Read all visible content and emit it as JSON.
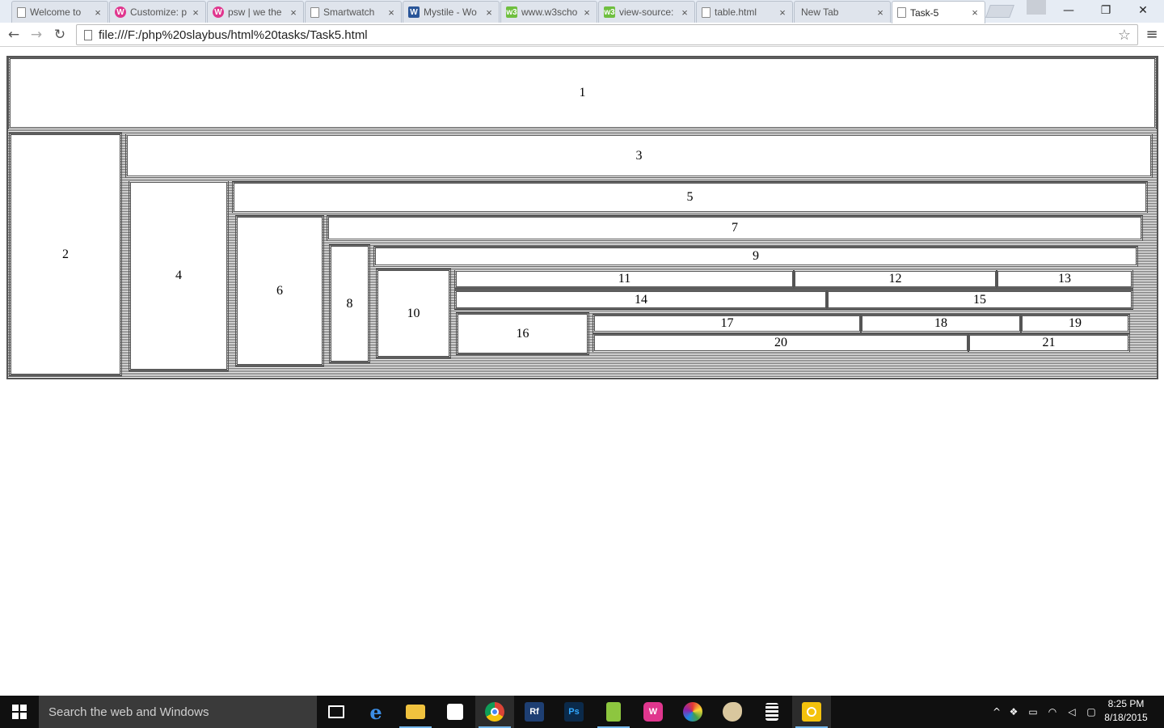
{
  "browser": {
    "tabs": [
      {
        "title": "Welcome to",
        "favicon": "doc-icon",
        "active": false
      },
      {
        "title": "Customize: p",
        "favicon": "wp-icon",
        "active": false
      },
      {
        "title": "psw | we the",
        "favicon": "wp-icon",
        "active": false
      },
      {
        "title": "Smartwatch",
        "favicon": "doc-icon",
        "active": false
      },
      {
        "title": "Mystile - Wo",
        "favicon": "w-icon",
        "active": false
      },
      {
        "title": "www.w3scho",
        "favicon": "w3-icon",
        "active": false
      },
      {
        "title": "view-source:",
        "favicon": "w3-icon",
        "active": false
      },
      {
        "title": "table.html",
        "favicon": "doc-icon",
        "active": false
      },
      {
        "title": "New Tab",
        "favicon": "none",
        "active": false
      },
      {
        "title": "Task-5",
        "favicon": "doc-icon",
        "active": true
      }
    ],
    "tab_close_glyph": "×",
    "url": "file:///F:/php%20slaybus/html%20tasks/Task5.html",
    "nav": {
      "back": "←",
      "forward": "→",
      "reload": "↻",
      "star": "☆",
      "menu": "≡"
    },
    "window_controls": {
      "minimize": "—",
      "restore": "❐",
      "close": "✕"
    }
  },
  "page": {
    "cells": {
      "c1": "1",
      "c2": "2",
      "c3": "3",
      "c4": "4",
      "c5": "5",
      "c6": "6",
      "c7": "7",
      "c8": "8",
      "c9": "9",
      "c10": "10",
      "c11": "11",
      "c12": "12",
      "c13": "13",
      "c14": "14",
      "c15": "15",
      "c16": "16",
      "c17": "17",
      "c18": "18",
      "c19": "19",
      "c20": "20",
      "c21": "21"
    }
  },
  "taskbar": {
    "search_placeholder": "Search the web and Windows",
    "apps": [
      {
        "name": "task-view-icon"
      },
      {
        "name": "edge-icon"
      },
      {
        "name": "file-explorer-icon"
      },
      {
        "name": "store-icon"
      },
      {
        "name": "chrome-icon"
      },
      {
        "name": "reflector-icon",
        "label": "Rf"
      },
      {
        "name": "photoshop-icon",
        "label": "Ps"
      },
      {
        "name": "notepad-plus-icon"
      },
      {
        "name": "wordpress-icon"
      },
      {
        "name": "paint-icon"
      },
      {
        "name": "paint-palette-icon"
      },
      {
        "name": "calculator-icon"
      },
      {
        "name": "sticky-app-icon"
      }
    ],
    "clock": {
      "time": "8:25 PM",
      "date": "8/18/2015"
    }
  }
}
